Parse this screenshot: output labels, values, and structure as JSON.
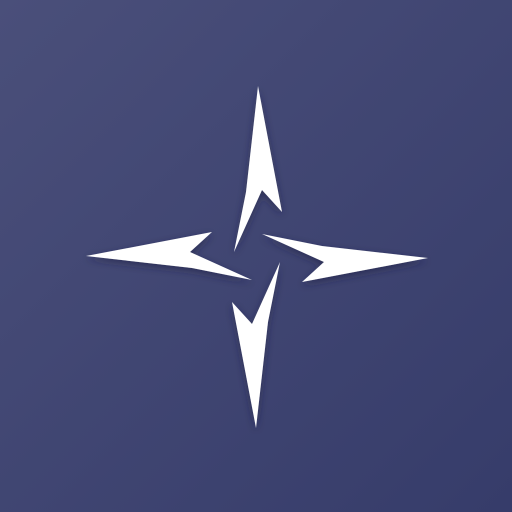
{
  "app_icon": {
    "icon_name": "four-point-star-compass-icon",
    "colors": {
      "background_start": "#4a4f7a",
      "background_end": "#363c6a",
      "mark": "#ffffff",
      "shadow": "#1c2040"
    }
  }
}
